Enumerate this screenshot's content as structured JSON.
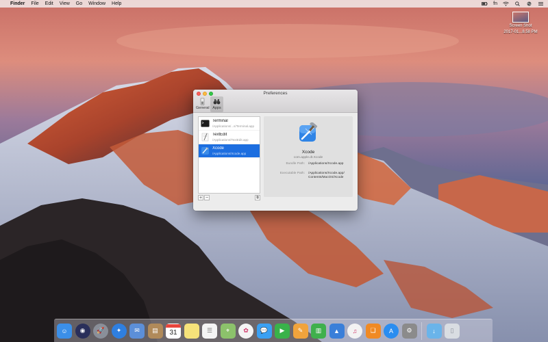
{
  "menubar": {
    "apple_glyph": "",
    "items": [
      {
        "label": "Finder"
      },
      {
        "label": "File"
      },
      {
        "label": "Edit"
      },
      {
        "label": "View"
      },
      {
        "label": "Go"
      },
      {
        "label": "Window"
      },
      {
        "label": "Help"
      }
    ],
    "fn_label": "fn"
  },
  "desktop_file": {
    "name": "Screen Shot",
    "subtitle": "2017-01...8.58 PM"
  },
  "window": {
    "title": "Preferences",
    "toolbar": [
      {
        "label": "General",
        "icon": "switch-icon"
      },
      {
        "label": "Apps",
        "icon": "binoculars-icon"
      }
    ],
    "apps": [
      {
        "name": "Terminal",
        "path": "/Applications/...s/Terminal.app",
        "icon": "terminal-icon"
      },
      {
        "name": "TextEdit",
        "path": "/Applications/TextEdit.app",
        "icon": "textedit-icon"
      },
      {
        "name": "Xcode",
        "path": "/Applications/Xcode.app",
        "icon": "xcode-icon"
      }
    ],
    "footer": {
      "add": "+",
      "remove": "−",
      "action": "⧉"
    },
    "detail": {
      "name": "Xcode",
      "bundle_id": "com.apple.dt.Xcode",
      "bundle_path_label": "Bundle Path:",
      "bundle_path_value": "/Applications/Xcode.app",
      "exec_path_label": "Executable Path:",
      "exec_path_value_1": "/Applications/Xcode.app/",
      "exec_path_value_2": "Contents/MacOS/Xcode"
    }
  },
  "dock": {
    "items": [
      {
        "name": "Finder",
        "icon": "finder-icon",
        "color": "#3b8fe8"
      },
      {
        "name": "Siri",
        "icon": "siri-icon",
        "color": "#2a2f5a"
      },
      {
        "name": "Launchpad",
        "icon": "launchpad-icon",
        "color": "#8a8f99"
      },
      {
        "name": "Safari",
        "icon": "safari-icon",
        "color": "#2f7fe0"
      },
      {
        "name": "Mail",
        "icon": "mail-icon",
        "color": "#5c8fd8"
      },
      {
        "name": "Contacts",
        "icon": "contacts-icon",
        "color": "#b08a5a"
      },
      {
        "name": "Calendar",
        "icon": "calendar-icon",
        "color": "#ffffff"
      },
      {
        "name": "Notes",
        "icon": "notes-icon",
        "color": "#f6e27a"
      },
      {
        "name": "Reminders",
        "icon": "reminders-icon",
        "color": "#f4f4f4"
      },
      {
        "name": "Maps",
        "icon": "maps-icon",
        "color": "#8cc26b"
      },
      {
        "name": "Photos",
        "icon": "photos-icon",
        "color": "#f4f4f4"
      },
      {
        "name": "Messages",
        "icon": "messages-icon",
        "color": "#3aa0f2"
      },
      {
        "name": "FaceTime",
        "icon": "facetime-icon",
        "color": "#39b24a"
      },
      {
        "name": "Pages",
        "icon": "pages-icon",
        "color": "#f0a33c"
      },
      {
        "name": "Numbers",
        "icon": "numbers-icon",
        "color": "#3fb04c"
      },
      {
        "name": "Keynote",
        "icon": "keynote-icon",
        "color": "#3a7fd9"
      },
      {
        "name": "iTunes",
        "icon": "itunes-icon",
        "color": "#f3f3f3"
      },
      {
        "name": "iBooks",
        "icon": "ibooks-icon",
        "color": "#f08a24"
      },
      {
        "name": "App Store",
        "icon": "appstore-icon",
        "color": "#2a8df0"
      },
      {
        "name": "System Preferences",
        "icon": "system-preferences-icon",
        "color": "#8b8b8b"
      },
      {
        "name": "Downloads",
        "icon": "downloads-folder-icon",
        "color": "#6ab4ea"
      },
      {
        "name": "Trash",
        "icon": "trash-icon",
        "color": "#d9dde2"
      }
    ],
    "calendar_day": "31"
  }
}
